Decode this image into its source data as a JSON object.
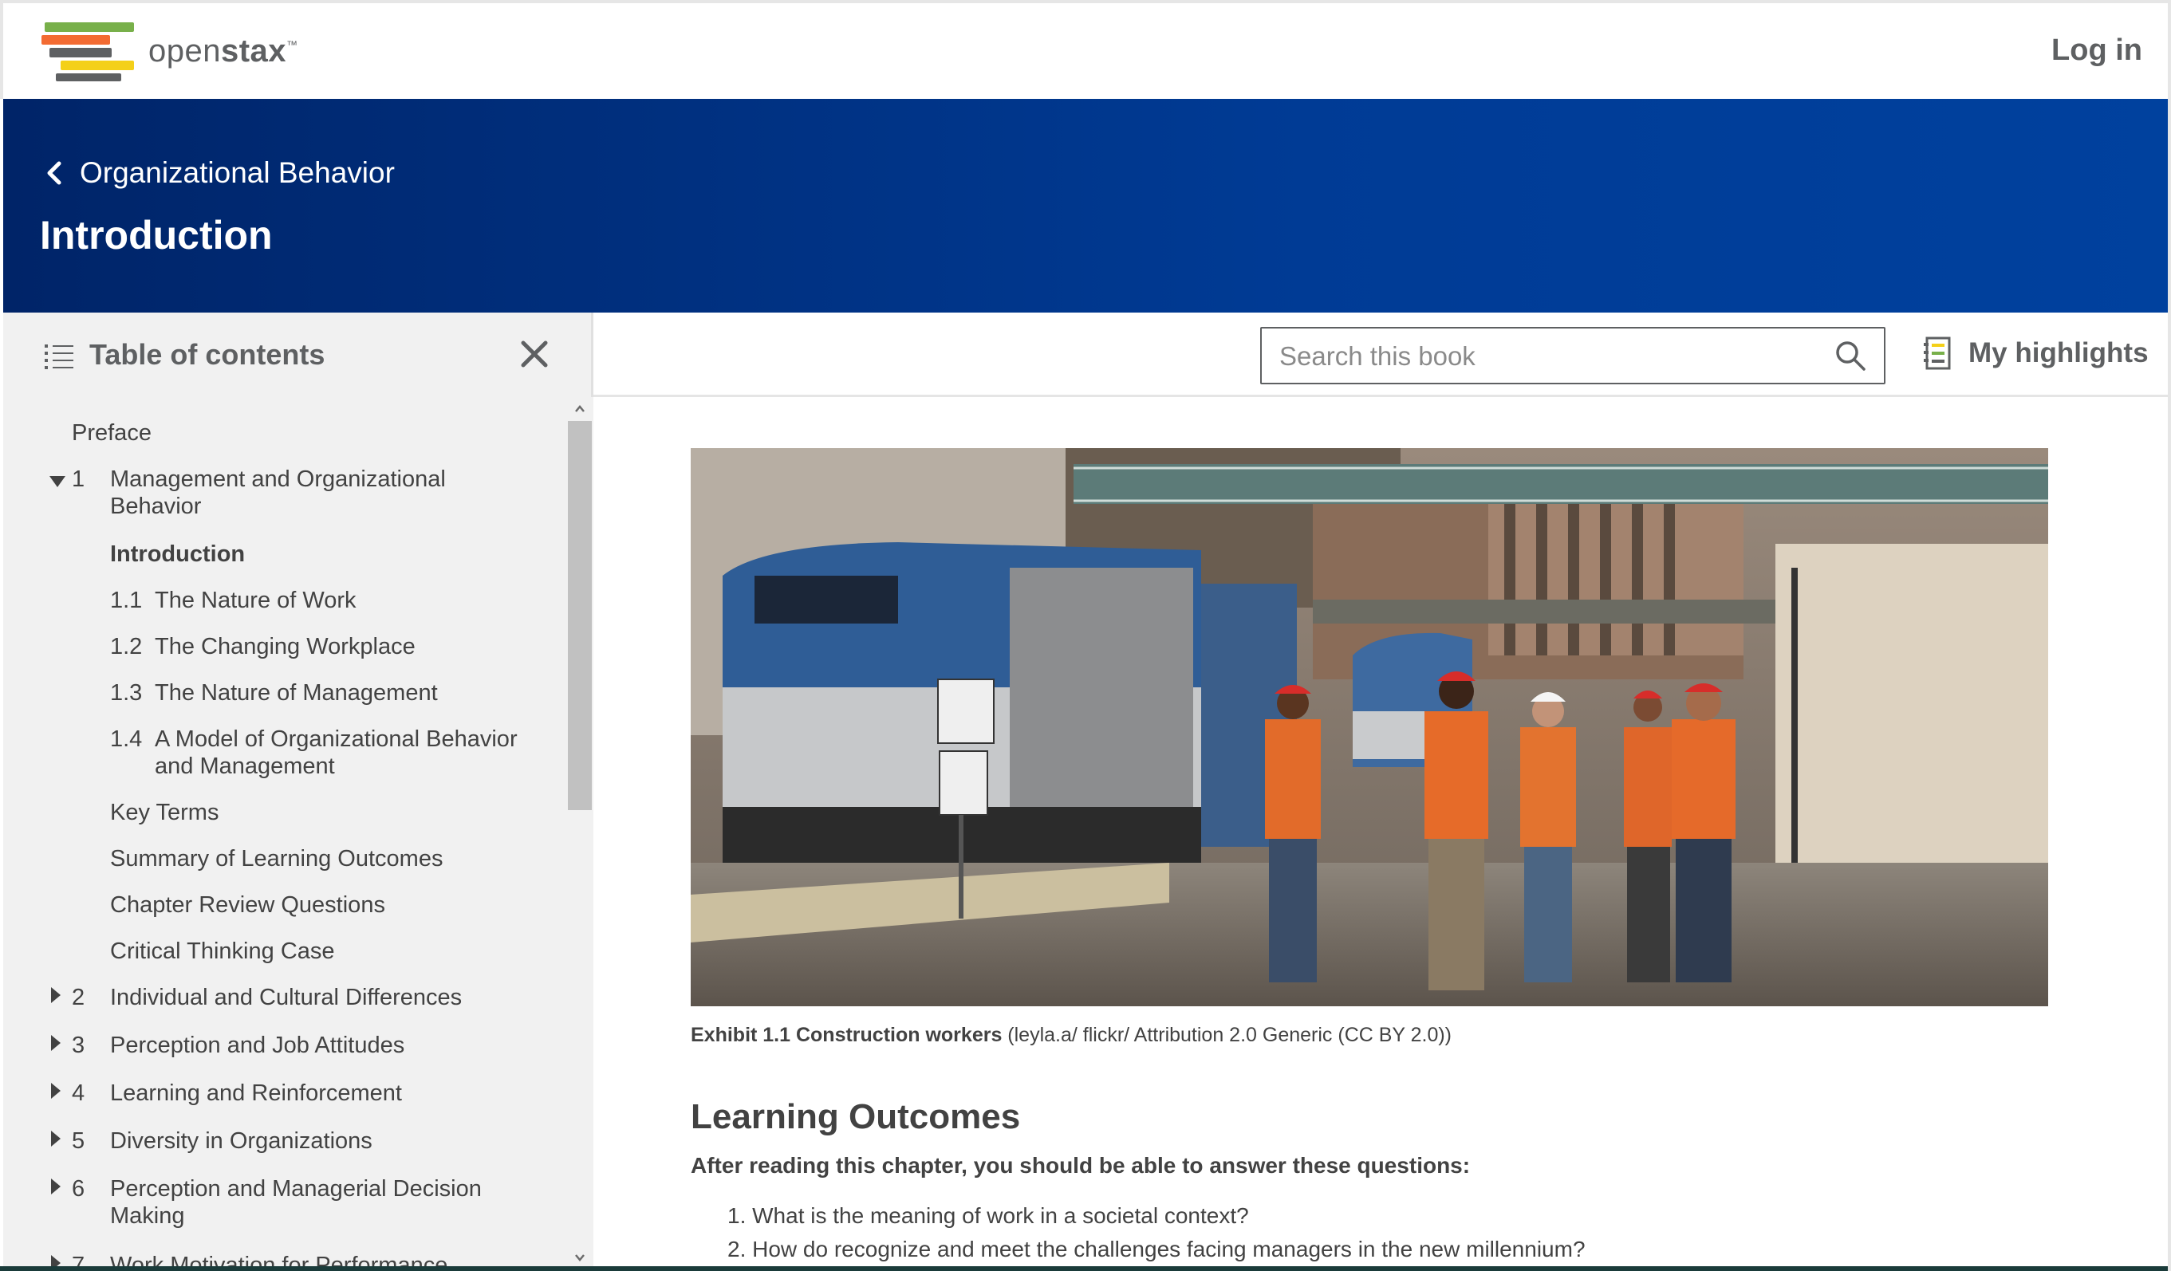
{
  "header": {
    "logo_text_light": "open",
    "logo_text_bold": "stax",
    "logo_tm": "™",
    "login_label": "Log in"
  },
  "book": {
    "back_label": "Organizational Behavior",
    "page_title": "Introduction"
  },
  "toc": {
    "title": "Table of contents",
    "items": [
      {
        "num": "",
        "label": "Preface"
      },
      {
        "num": "1",
        "label": "Management and Organizational",
        "label2": "Behavior"
      },
      {
        "num": "",
        "label": "Introduction"
      },
      {
        "num": "1.1",
        "label": "The Nature of Work"
      },
      {
        "num": "1.2",
        "label": "The Changing Workplace"
      },
      {
        "num": "1.3",
        "label": "The Nature of Management"
      },
      {
        "num": "1.4",
        "label": "A Model of Organizational Behavior",
        "label2": "and Management"
      },
      {
        "num": "",
        "label": "Key Terms"
      },
      {
        "num": "",
        "label": "Summary of Learning Outcomes"
      },
      {
        "num": "",
        "label": "Chapter Review Questions"
      },
      {
        "num": "",
        "label": "Critical Thinking Case"
      },
      {
        "num": "2",
        "label": "Individual and Cultural Differences"
      },
      {
        "num": "3",
        "label": "Perception and Job Attitudes"
      },
      {
        "num": "4",
        "label": "Learning and Reinforcement"
      },
      {
        "num": "5",
        "label": "Diversity in Organizations"
      },
      {
        "num": "6",
        "label": "Perception and Managerial Decision",
        "label2": "Making"
      },
      {
        "num": "7",
        "label": "Work Motivation for Performance"
      }
    ]
  },
  "toolbar": {
    "search_placeholder": "Search this book",
    "highlights_label": "My highlights"
  },
  "content": {
    "caption_bold": "Exhibit 1.1 Construction workers",
    "caption_rest": " (leyla.a/ flickr/ Attribution 2.0 Generic (CC BY 2.0))",
    "lo_title": "Learning Outcomes",
    "lo_intro": "After reading this chapter, you should be able to answer these questions:",
    "lo_items": [
      "1. What is the meaning of work in a societal context?",
      "2. How do recognize and meet the challenges facing managers in the new millennium?"
    ]
  },
  "colors": {
    "band": "#002468",
    "band_end": "#00419e",
    "sidebar_bg": "#f1f1f1",
    "text": "#424242",
    "muted": "#5e6062"
  }
}
